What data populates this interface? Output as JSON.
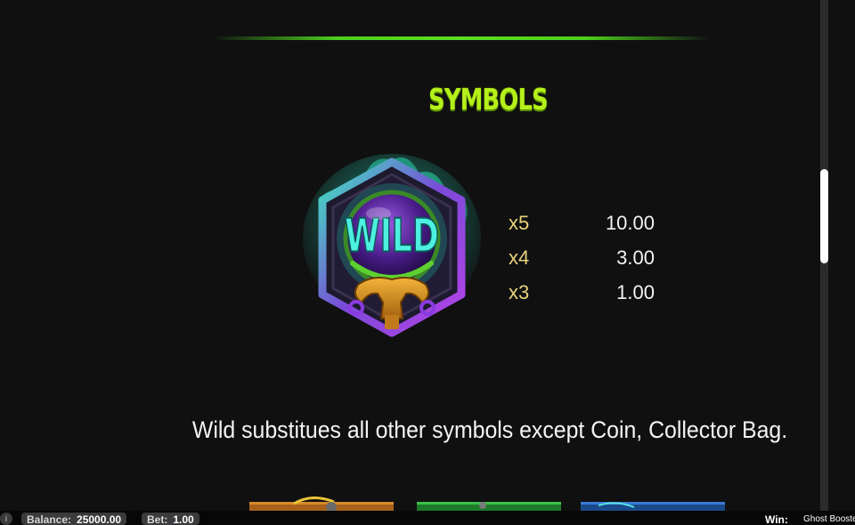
{
  "section": {
    "title": "SYMBOLS"
  },
  "symbol": {
    "name": "WILD",
    "icon": "crystal-ball-wild-icon",
    "payouts": [
      {
        "count": "x5",
        "value": "10.00"
      },
      {
        "count": "x4",
        "value": "3.00"
      },
      {
        "count": "x3",
        "value": "1.00"
      }
    ],
    "description": "Wild substitues all other symbols except Coin, Collector Bag."
  },
  "next_symbols": [
    "orange-symbol-icon",
    "green-symbol-icon",
    "blue-symbol-icon"
  ],
  "status_bar": {
    "logo": "i",
    "balance_label": "Balance:",
    "balance_value": "25000.00",
    "bet_label": "Bet:",
    "bet_value": "1.00",
    "win_label": "Win:",
    "game_name": "Ghost Booster"
  },
  "colors": {
    "title": "#b6f01a",
    "accent_line": "#5ae020",
    "payout_count": "#e9d27a"
  }
}
